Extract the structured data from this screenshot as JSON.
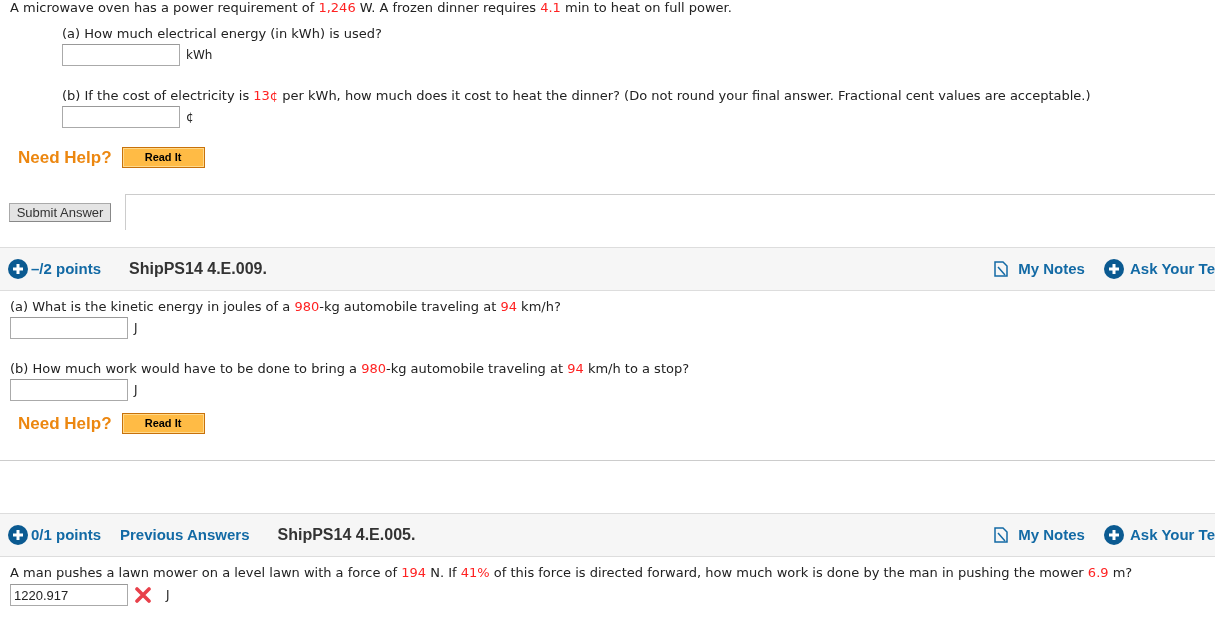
{
  "questions": [
    {
      "intro": [
        {
          "text": "A microwave oven has a power requirement of ",
          "highlight": false
        },
        {
          "text": "1,246",
          "highlight": true
        },
        {
          "text": " W. A frozen dinner requires ",
          "highlight": false
        },
        {
          "text": "4.1",
          "highlight": true
        },
        {
          "text": " min to heat on full power.",
          "highlight": false
        }
      ],
      "parts": [
        {
          "prompt": [
            {
              "text": "(a) How much electrical energy (in kWh) is used?",
              "highlight": false
            }
          ],
          "unit": "kWh"
        },
        {
          "prompt": [
            {
              "text": "(b) If the cost of electricity is ",
              "highlight": false
            },
            {
              "text": "13¢",
              "highlight": true
            },
            {
              "text": " per kWh, how much does it cost to heat the dinner? (Do not round your final answer. Fractional cent values are acceptable.)",
              "highlight": false
            }
          ],
          "unit": "¢"
        }
      ],
      "help": {
        "label": "Need Help?",
        "buttons": [
          "Read It"
        ]
      },
      "submit": "Submit Answer"
    },
    {
      "header": {
        "points": "–/2 points",
        "code": "ShipPS14 4.E.009.",
        "links": [
          {
            "kind": "notes",
            "label": "My Notes"
          },
          {
            "kind": "ask",
            "label": "Ask Your Te"
          }
        ]
      },
      "parts": [
        {
          "prompt": [
            {
              "text": "(a) What is the kinetic energy in joules of a ",
              "highlight": false
            },
            {
              "text": "980",
              "highlight": true
            },
            {
              "text": "-kg automobile traveling at ",
              "highlight": false
            },
            {
              "text": "94",
              "highlight": true
            },
            {
              "text": " km/h?",
              "highlight": false
            }
          ],
          "unit": "J"
        },
        {
          "prompt": [
            {
              "text": "(b) How much work would have to be done to bring a ",
              "highlight": false
            },
            {
              "text": "980",
              "highlight": true
            },
            {
              "text": "-kg automobile traveling at ",
              "highlight": false
            },
            {
              "text": "94",
              "highlight": true
            },
            {
              "text": " km/h to a stop?",
              "highlight": false
            }
          ],
          "unit": "J"
        }
      ],
      "help": {
        "label": "Need Help?",
        "buttons": [
          "Read It"
        ]
      }
    },
    {
      "header": {
        "points": "0/1 points",
        "previous_answers": "Previous Answers",
        "code": "ShipPS14 4.E.005.",
        "links": [
          {
            "kind": "notes",
            "label": "My Notes"
          },
          {
            "kind": "ask",
            "label": "Ask Your Te"
          }
        ]
      },
      "parts": [
        {
          "prompt": [
            {
              "text": "A man pushes a lawn mower on a level lawn with a force of ",
              "highlight": false
            },
            {
              "text": "194",
              "highlight": true
            },
            {
              "text": " N. If ",
              "highlight": false
            },
            {
              "text": "41%",
              "highlight": true
            },
            {
              "text": " of this force is directed forward, how much work is done by the man in pushing the mower ",
              "highlight": false
            },
            {
              "text": "6.9",
              "highlight": true
            },
            {
              "text": " m?",
              "highlight": false
            }
          ],
          "answer": "1220.917",
          "correct": false,
          "unit": "J"
        }
      ]
    }
  ]
}
